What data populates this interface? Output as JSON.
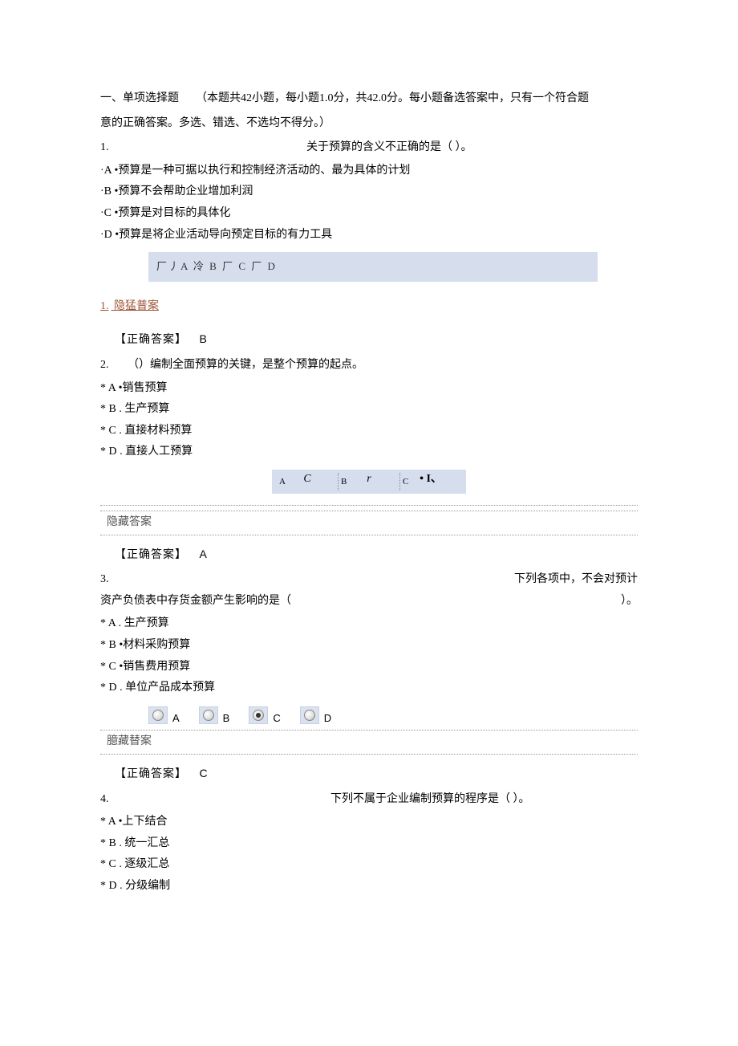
{
  "section": {
    "title": "一、单项选择题",
    "note_line1": "（本题共42小题，每小题1.0分，共42.0分。每小题备选答案中，只有一个符合题",
    "note_line2": "意的正确答案。多选、错选、不选均不得分。）"
  },
  "q1": {
    "num": "1.",
    "stem": "关于预算的含义不正确的是（      ）。",
    "optA": "·A •预算是一种可据以执行和控制经济活动的、最为具体的计划",
    "optB": "·B •预算不会帮助企业增加利润",
    "optC": "·C •预算是对目标的具体化",
    "optD": "·D •预算是将企业活动导向预定目标的有力工具",
    "strip": "厂丿A 冷 B 厂 C 厂 D",
    "hide_link_num": "1.",
    "hide_link_text": "隐猛普案",
    "correct_label": "【正确答案】",
    "correct_val": "B"
  },
  "q2": {
    "num": "2.",
    "stem": "（）编制全面预算的关键，是整个预算的起点。",
    "optA": "*  A •销售预算",
    "optB": "*  B . 生产预算",
    "optC": "*  C . 直接材料预算",
    "optD": "*  D . 直接人工预算",
    "strip_items": [
      {
        "label": "A",
        "mark": "C"
      },
      {
        "label": "B",
        "mark": "r"
      },
      {
        "label": "C",
        "mark": "• I、"
      }
    ],
    "hide_text": "隐藏答案",
    "correct_label": "【正确答案】",
    "correct_val": "A"
  },
  "q3": {
    "num": "3.",
    "stem_right": "下列各项中，不会对预计",
    "stem_line2_left": "资产负债表中存货金额产生影响的是（",
    "stem_line2_right": "）。",
    "optA": "*  A . 生产预算",
    "optB": "*  B •材料采购预算",
    "optC": "*  C •销售费用预算",
    "optD": "*  D . 单位产品成本预算",
    "radios": [
      {
        "label": "A",
        "checked": false
      },
      {
        "label": "B",
        "checked": false
      },
      {
        "label": "C",
        "checked": true
      },
      {
        "label": "D",
        "checked": false
      }
    ],
    "hide_text": "臆藏替案",
    "correct_label": "【正确答案】",
    "correct_val": "C"
  },
  "q4": {
    "num": "4.",
    "stem": "下列不属于企业编制预算的程序是（ ）。",
    "optA": "*  A •上下结合",
    "optB": "*  B . 统一汇总",
    "optC": "*  C . 逐级汇总",
    "optD": "*  D . 分级编制"
  }
}
